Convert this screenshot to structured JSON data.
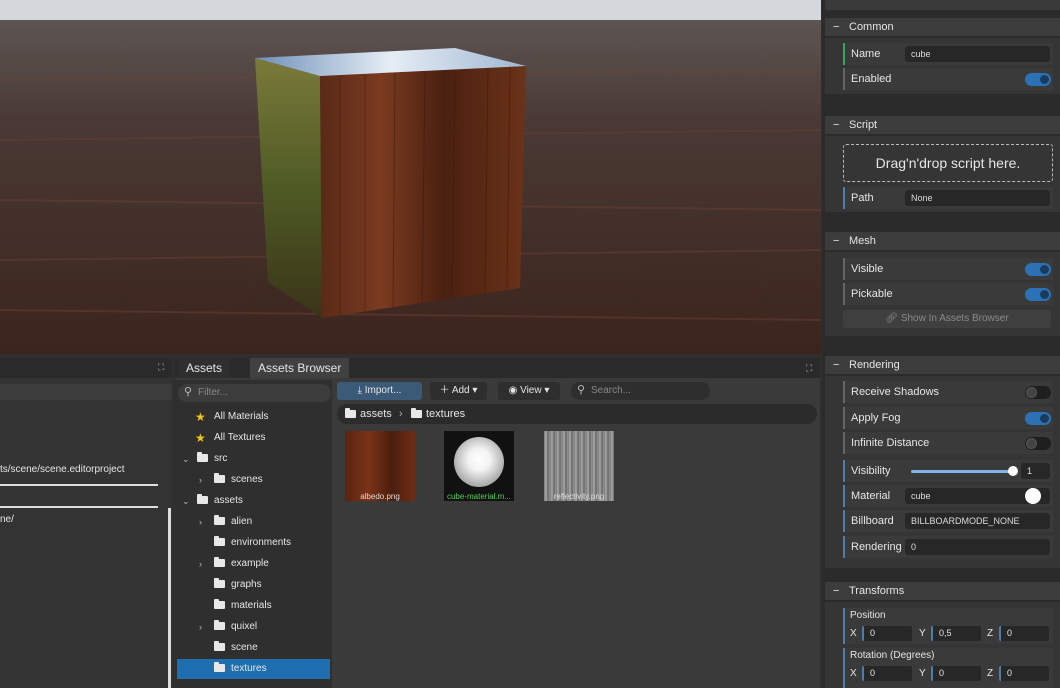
{
  "viewport": {},
  "left_panel": {
    "path_text": "ts/scene/scene.editorproject",
    "path_text2": "ne/"
  },
  "assets": {
    "tabs": [
      "Assets",
      "Assets Browser"
    ],
    "filter_placeholder": "Filter...",
    "toolbar": {
      "import": "Import...",
      "add": "Add",
      "view": "View",
      "search_placeholder": "Search..."
    },
    "breadcrumb": [
      "assets",
      "textures"
    ],
    "tree": [
      {
        "label": "All Materials"
      },
      {
        "label": "All Textures"
      },
      {
        "label": "src"
      },
      {
        "label": "scenes"
      },
      {
        "label": "assets"
      },
      {
        "label": "alien"
      },
      {
        "label": "environments"
      },
      {
        "label": "example"
      },
      {
        "label": "graphs"
      },
      {
        "label": "materials"
      },
      {
        "label": "quixel"
      },
      {
        "label": "scene"
      },
      {
        "label": "textures"
      }
    ],
    "files": [
      {
        "name": "albedo.png"
      },
      {
        "name": "cube-material.m..."
      },
      {
        "name": "reflectivity.png"
      }
    ]
  },
  "inspector": {
    "common": {
      "title": "Common",
      "name_label": "Name",
      "name_value": "cube",
      "enabled_label": "Enabled"
    },
    "script": {
      "title": "Script",
      "drop_text": "Drag'n'drop script here.",
      "path_label": "Path",
      "path_value": "None"
    },
    "mesh": {
      "title": "Mesh",
      "visible_label": "Visible",
      "pickable_label": "Pickable",
      "show_button": "Show In Assets Browser"
    },
    "rendering": {
      "title": "Rendering",
      "receive_shadows": "Receive Shadows",
      "apply_fog": "Apply Fog",
      "infinite_distance": "Infinite Distance",
      "visibility_label": "Visibility",
      "visibility_value": "1",
      "material_label": "Material",
      "material_value": "cube",
      "billboard_label": "Billboard",
      "billboard_value": "BILLBOARDMODE_NONE",
      "rendering_group_label": "Rendering Gr",
      "rendering_group_value": "0"
    },
    "transforms": {
      "title": "Transforms",
      "position_label": "Position",
      "position": {
        "x": "0",
        "y": "0,5",
        "z": "0"
      },
      "rotation_label": "Rotation (Degrees)",
      "rotation": {
        "x": "0",
        "y": "0",
        "z": "0"
      },
      "axis_x": "X",
      "axis_y": "Y",
      "axis_z": "Z"
    }
  },
  "colors": {
    "accent": "#1f6fb0",
    "toggle_on": "#2a72b5",
    "highlight_green": "#4fd04f"
  }
}
